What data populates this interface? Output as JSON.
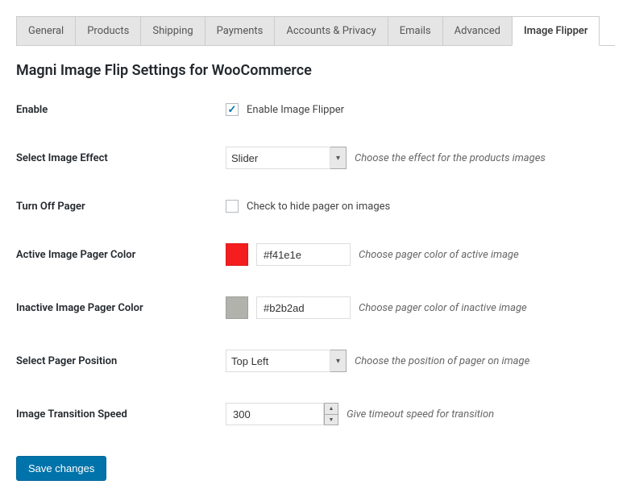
{
  "tabs": [
    {
      "label": "General",
      "active": false
    },
    {
      "label": "Products",
      "active": false
    },
    {
      "label": "Shipping",
      "active": false
    },
    {
      "label": "Payments",
      "active": false
    },
    {
      "label": "Accounts & Privacy",
      "active": false
    },
    {
      "label": "Emails",
      "active": false
    },
    {
      "label": "Advanced",
      "active": false
    },
    {
      "label": "Image Flipper",
      "active": true
    }
  ],
  "heading": "Magni Image Flip Settings for WooCommerce",
  "rows": {
    "enable": {
      "label": "Enable",
      "checkbox_label": "Enable Image Flipper",
      "checked": true
    },
    "effect": {
      "label": "Select Image Effect",
      "value": "Slider",
      "description": "Choose the effect for the products images"
    },
    "turn_off_pager": {
      "label": "Turn Off Pager",
      "checkbox_label": "Check to hide pager on images",
      "checked": false
    },
    "active_color": {
      "label": "Active Image Pager Color",
      "value": "#f41e1e",
      "swatch": "#f41e1e",
      "description": "Choose pager color of active image"
    },
    "inactive_color": {
      "label": "Inactive Image Pager Color",
      "value": "#b2b2ad",
      "swatch": "#b2b2ad",
      "description": "Choose pager color of inactive image"
    },
    "pager_position": {
      "label": "Select Pager Position",
      "value": "Top Left",
      "description": "Choose the position of pager on image"
    },
    "transition_speed": {
      "label": "Image Transition Speed",
      "value": "300",
      "description": "Give timeout speed for transition"
    }
  },
  "save_button": "Save changes"
}
